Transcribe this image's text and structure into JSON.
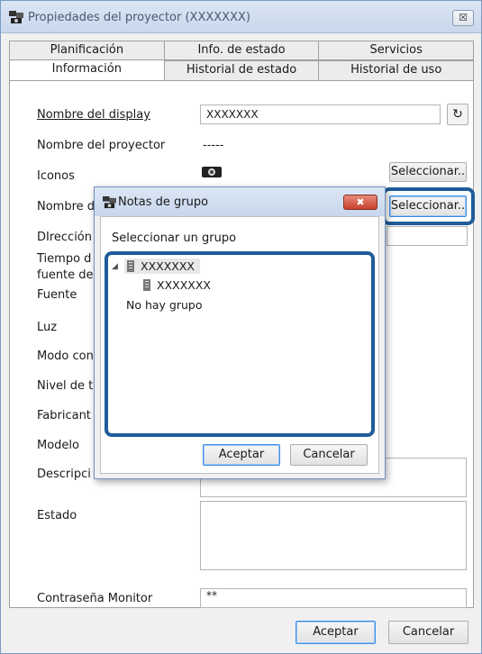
{
  "window": {
    "title": "Propiedades del proyector (XXXXXXX)",
    "close_glyph": "☒",
    "app_icon": "projector-network-icon"
  },
  "tabs_back": [
    "Planificación",
    "Info. de estado",
    "Servicios"
  ],
  "tabs_front": [
    "Información",
    "Historial de estado",
    "Historial de uso"
  ],
  "form": {
    "nombre_display_label": "Nombre del display",
    "nombre_display_value": "XXXXXXX",
    "nombre_proyector_label": "Nombre del proyector",
    "nombre_proyector_value": "-----",
    "iconos_label": "Iconos",
    "seleccionar_icon_btn": "Seleccionar..",
    "nombre_grupo_label": "Nombre d",
    "seleccionar_grupo_btn": "Seleccionar..",
    "direccion_label": "DIrección",
    "tiempo_label_1": "Tiempo d",
    "tiempo_label_2": "fuente de",
    "fuente_label": "Fuente",
    "luz_label": "Luz",
    "modo_label": "Modo con",
    "nivel_label": "Nivel de t",
    "fabricante_label": "Fabricant",
    "modelo_label": "Modelo",
    "descripcion_label": "Descripci",
    "estado_label": "Estado",
    "contrasena_label": "Contraseña Monitor",
    "contrasena_value": "**"
  },
  "footer": {
    "aceptar": "Aceptar",
    "cancelar": "Cancelar"
  },
  "modal": {
    "title": "Notas de grupo",
    "close_glyph": "✖",
    "prompt": "Seleccionar un grupo",
    "tree": {
      "expand_glyph": "◢",
      "root": "XXXXXXX",
      "child": "XXXXXXX",
      "no_group": "No hay grupo"
    },
    "aceptar": "Aceptar",
    "cancelar": "Cancelar"
  },
  "colors": {
    "highlight": "#1f5c99",
    "primary_button_border": "#3c8ce6",
    "modal_close": "#c8422e"
  }
}
